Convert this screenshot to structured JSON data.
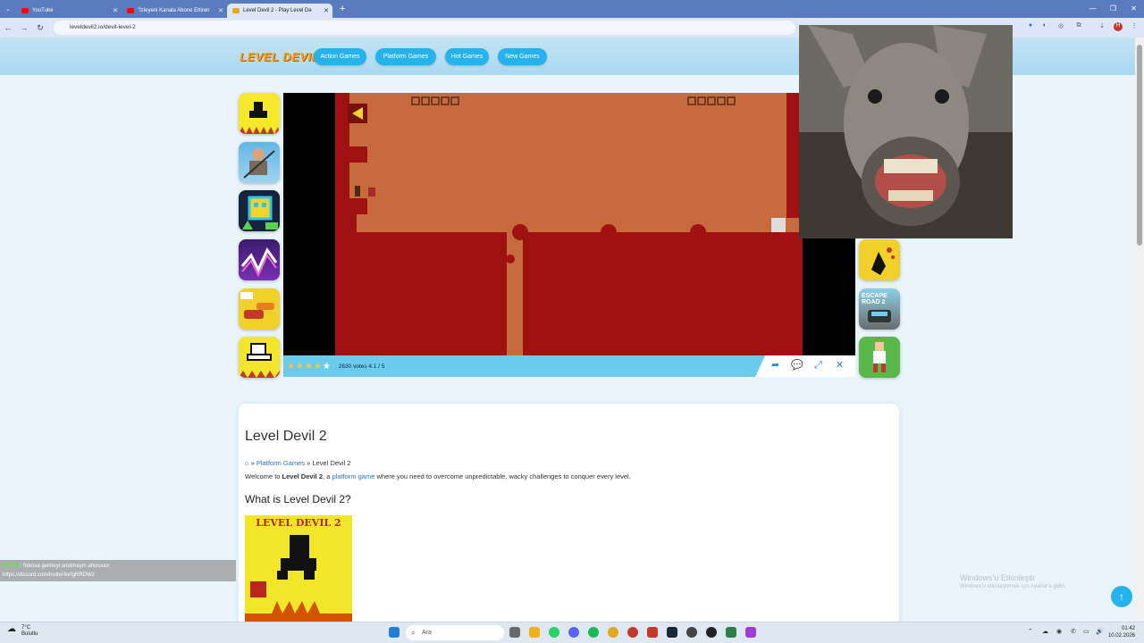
{
  "browser": {
    "tabs": [
      {
        "title": "YouTube",
        "icon": "youtube-icon",
        "color": "#ff0000"
      },
      {
        "title": "\"İzleyeni Kanala Abone Ettiren",
        "icon": "youtube-icon",
        "color": "#ff0000"
      },
      {
        "title": "Level Devil 2 - Play Level De",
        "icon": "game-favicon",
        "color": "#f2a41c"
      }
    ],
    "url": "leveldevil2.io/devil-level-2"
  },
  "site": {
    "logo": "LEVEL DEVIL",
    "nav": [
      "Action Games",
      "Platform Games",
      "Hot Games",
      "New Games"
    ]
  },
  "game": {
    "rating_stars": 4.1,
    "votes_text": "2630 votes 4.1 / 5",
    "share_icon": "share-icon",
    "comment_icon": "comment-icon",
    "expand_icon": "expand-icon",
    "fullscreen_icon": "fullscreen-icon"
  },
  "article": {
    "title": "Level Devil 2",
    "breadcrumb_sep": "»",
    "breadcrumb_link": "Platform Games",
    "breadcrumb_current": "Level Devil 2",
    "intro_pre": "Welcome to ",
    "intro_bold": "Level Devil 2",
    "intro_mid": ", a ",
    "intro_link": "platform game",
    "intro_post": " where you need to overcome unpredictable, wacky challenges to conquer every level.",
    "subheading": "What is Level Devil 2?",
    "poster_title": "LEVEL DEVIL 2"
  },
  "overlay": {
    "chat_user": "BoTRix",
    "chat_line": ": fiskosa gelmeyi unutmayın ahuruuur",
    "chat_link": "https://discord.com/invite/4srfgRRDWz"
  },
  "os": {
    "watermark_title": "Windows'u Etkinleştir",
    "watermark_sub": "Windows'u etkinleştirmek için Ayarlar'a gidin.",
    "weather_temp": "7°C",
    "weather_desc": "Bulutlu",
    "search_placeholder": "Ara",
    "time": "01:42",
    "date": "10.02.2026"
  }
}
